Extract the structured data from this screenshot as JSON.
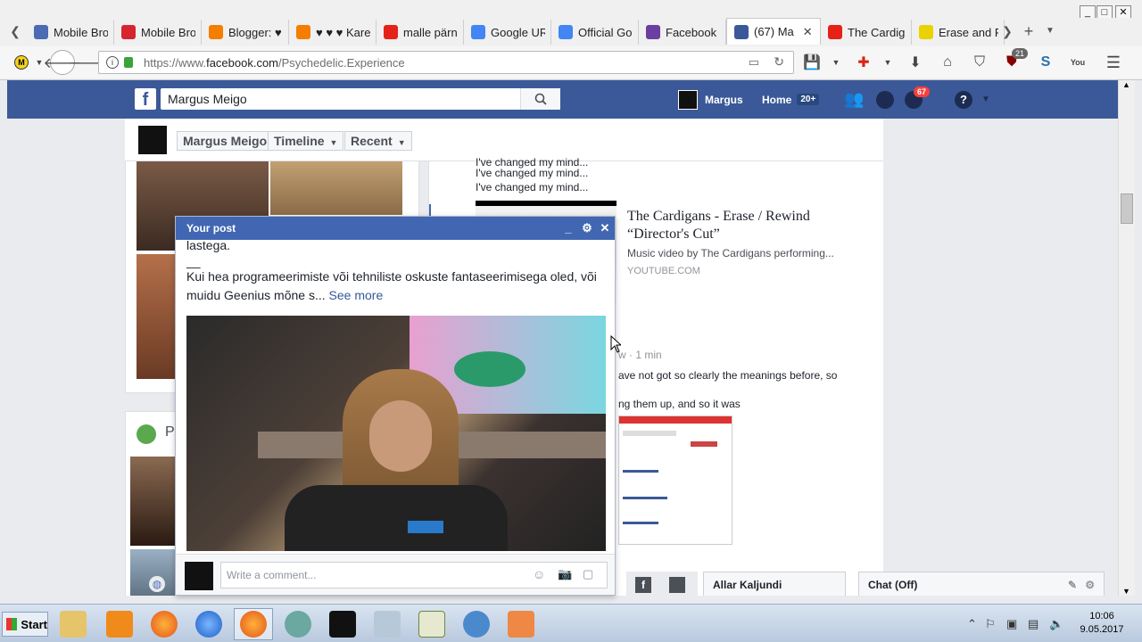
{
  "browser": {
    "tabs": [
      {
        "label": "Mobile Bro",
        "color": "#4b6bb3",
        "icon": "mobile-icon"
      },
      {
        "label": "Mobile Bro",
        "color": "#d6252e",
        "icon": "huawei-icon"
      },
      {
        "label": "Blogger: ♥",
        "color": "#f57d00",
        "icon": "blogger-icon"
      },
      {
        "label": "♥ ♥ ♥ Kare",
        "color": "#f57d00",
        "icon": "blogger-icon"
      },
      {
        "label": "malle pärn",
        "color": "#e62117",
        "icon": "youtube-icon"
      },
      {
        "label": "Google URL",
        "color": "#4285f4",
        "icon": "google-icon"
      },
      {
        "label": "Official Go",
        "color": "#4285f4",
        "icon": "google-icon"
      },
      {
        "label": "Facebook C",
        "color": "#6b3fa0",
        "icon": "facebook-dev-icon"
      },
      {
        "label": "(67) Ma",
        "color": "#3b5998",
        "icon": "facebook-icon",
        "active": true
      },
      {
        "label": "The Cardig",
        "color": "#e62117",
        "icon": "youtube-icon"
      },
      {
        "label": "Erase and R",
        "color": "#e8d200",
        "icon": "st-icon"
      }
    ],
    "url_prefix": "https://www.",
    "url_host": "facebook.com",
    "url_path": "/Psychedelic.Experience",
    "extension_badge": "21"
  },
  "fb": {
    "search_value": "Margus Meigo",
    "user_name": "Margus",
    "home_label": "Home",
    "home_badge": "20+",
    "notif_badge": "67",
    "help_icon": "?"
  },
  "timeline": {
    "name_btn": "Margus Meigo",
    "timeline_btn": "Timeline",
    "recent_btn": "Recent"
  },
  "left_col2": {
    "heading": "P"
  },
  "center": {
    "lyrics": [
      "I've changed my mind...",
      "I've changed my mind...",
      "I've changed my mind..."
    ],
    "yt_title": "The Cardigans - Erase / Rewind “Director's Cut”",
    "yt_desc": "Music video by The Cardigans performing...",
    "yt_domain": "YOUTUBE.COM",
    "comment_time": "w · 1 min",
    "comment_line1": "ave not got so clearly the meanings before, so",
    "comment_line2": "ng them up, and so it was"
  },
  "popup": {
    "title": "Your post",
    "body_top": "lastega.",
    "body_sep": "__",
    "body_text": "Kui hea programeerimiste või tehniliste oskuste fantaseerimisega oled, või muidu Geenius mõne s...",
    "see_more": "See more",
    "comment_placeholder": "Write a comment..."
  },
  "chat": {
    "friend_name": "Allar Kaljundi",
    "chat_label": "Chat (Off)"
  },
  "taskbar": {
    "start_label": "Start",
    "time": "10:06",
    "date": "9.05.2017"
  }
}
